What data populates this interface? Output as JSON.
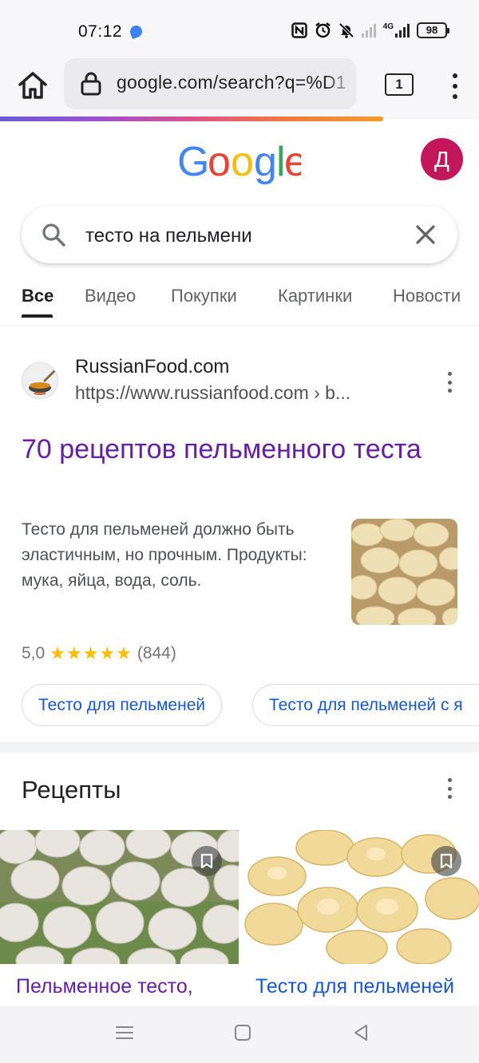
{
  "status": {
    "time": "07:12",
    "network": "4G",
    "battery": "98"
  },
  "browser": {
    "url": "google.com/search?q=%D1",
    "tab_count": "1"
  },
  "google": {
    "avatar_letter": "Д",
    "search_query": "тесто на пельмени",
    "tabs": [
      "Все",
      "Видео",
      "Покупки",
      "Картинки",
      "Новости"
    ]
  },
  "result": {
    "site_name": "RussianFood.com",
    "site_url": "https://www.russianfood.com › b...",
    "title": "70 рецептов пельменного теста",
    "snippet": "Тесто для пельменей должно быть эластичным, но прочным. Продукты: мука, яйца, вода, соль.",
    "rating": "5,0",
    "stars": "★★★★★",
    "rating_count": "(844)",
    "chips": [
      "Тесто для пельменей",
      "Тесто для пельменей с я"
    ]
  },
  "recipes": {
    "heading": "Рецепты",
    "cards": [
      {
        "label": "Пельменное тесто,",
        "color": "#681da8"
      },
      {
        "label": "Тесто для пельменей",
        "color": "#1558d6"
      }
    ]
  },
  "colors": {
    "visited_link": "#681da8",
    "link": "#1558d6",
    "avatar": "#c2185b",
    "stars": "#fbbc04"
  }
}
